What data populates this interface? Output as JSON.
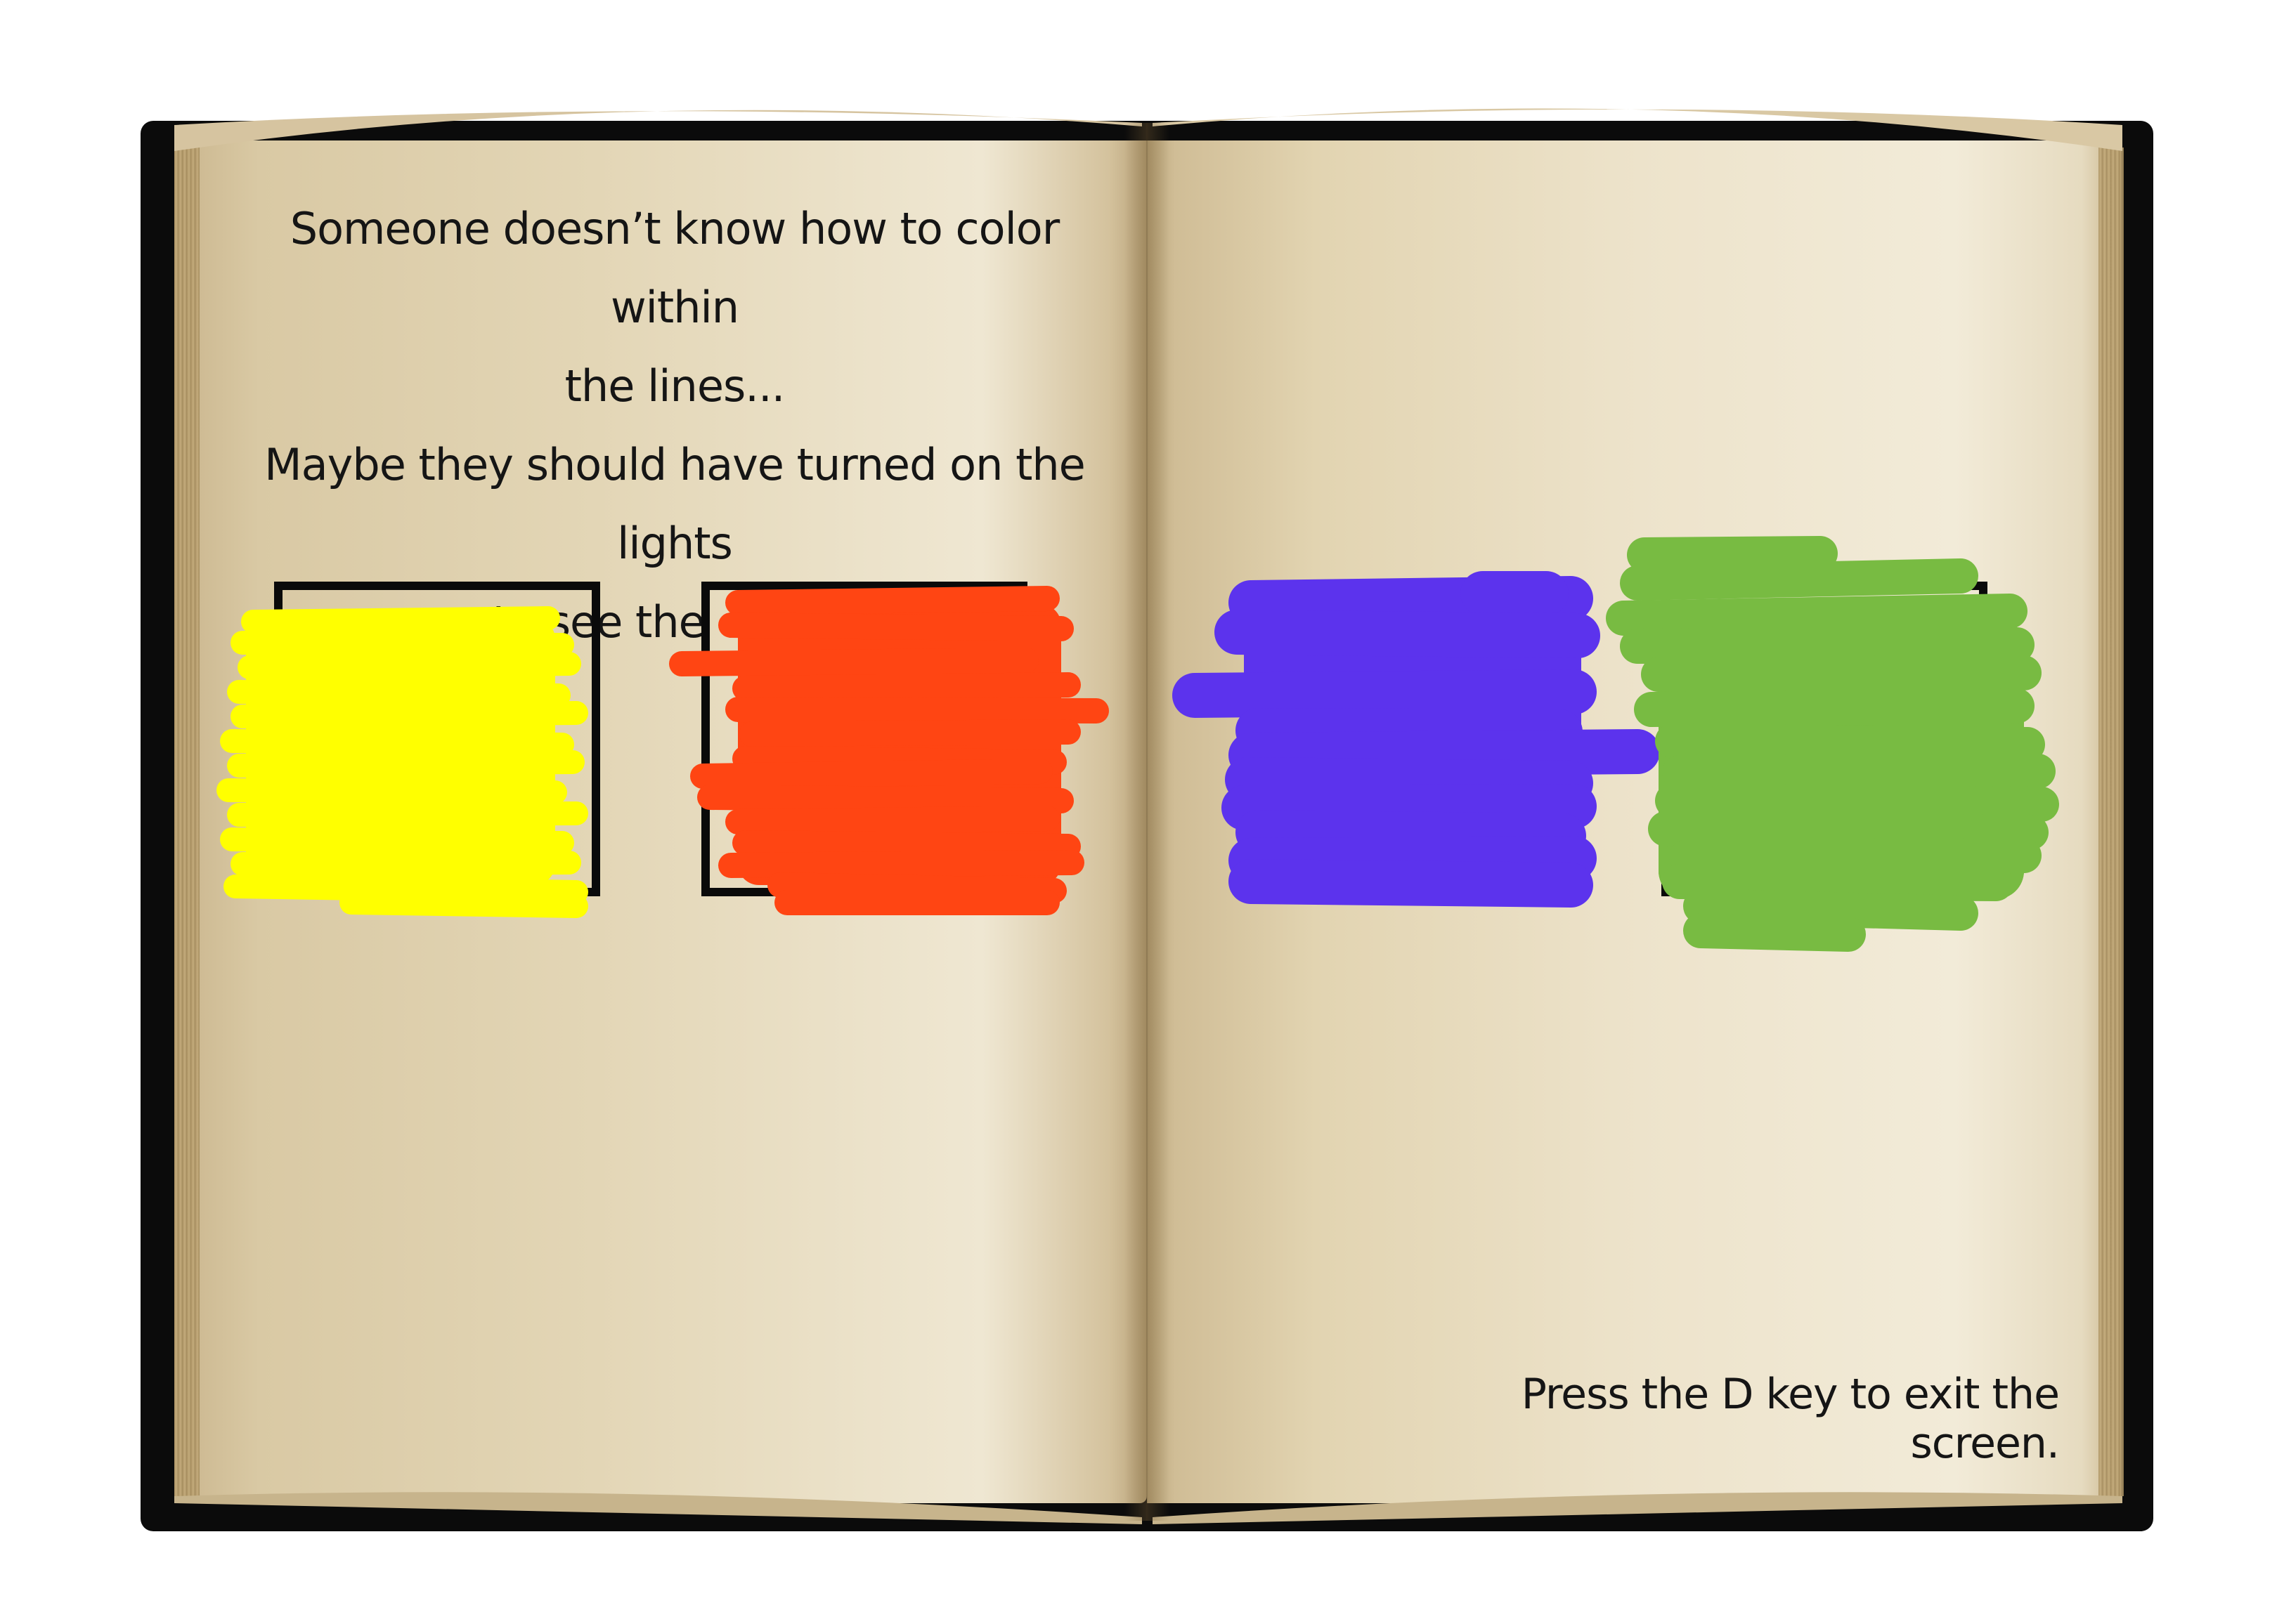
{
  "book": {
    "left_page": {
      "message_lines": [
        "Someone doesn’t know how to color within",
        "the lines...",
        "Maybe they should have turned on the lights",
        "to see the colors."
      ]
    },
    "right_page": {
      "hint": "Press the D key to exit the screen."
    }
  },
  "color_boxes": [
    {
      "name": "yellow",
      "color": "#ffff00"
    },
    {
      "name": "red-orange",
      "color": "#ff4513"
    },
    {
      "name": "purple",
      "color": "#5c33ed"
    },
    {
      "name": "green",
      "color": "#78bb42"
    }
  ],
  "colors": {
    "cover": "#0b0b0b",
    "ink": "#151515",
    "frame": "#0a0a0a",
    "green_underlay": "#8a6a3a"
  }
}
